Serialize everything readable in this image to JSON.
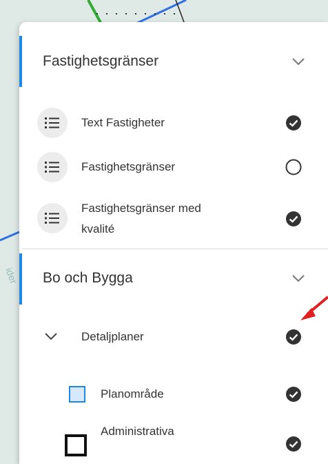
{
  "groups": [
    {
      "title": "Fastighetsgränser",
      "layers": [
        {
          "label": "Text Fastigheter",
          "checked": true
        },
        {
          "label": "Fastighetsgränser",
          "checked": false
        },
        {
          "label_line1": "Fastighetsgränser med",
          "label_line2": "kvalité",
          "checked": true
        }
      ]
    },
    {
      "title": "Bo och Bygga",
      "sublayers": [
        {
          "label": "Detaljplaner",
          "checked": true
        },
        {
          "label": "Planområde",
          "checked": true
        },
        {
          "label": "Administrativa",
          "checked": true
        }
      ]
    }
  ],
  "colors": {
    "accent": "#1e88e5",
    "annotation_arrow": "#e02020",
    "check_fill": "#333333"
  }
}
